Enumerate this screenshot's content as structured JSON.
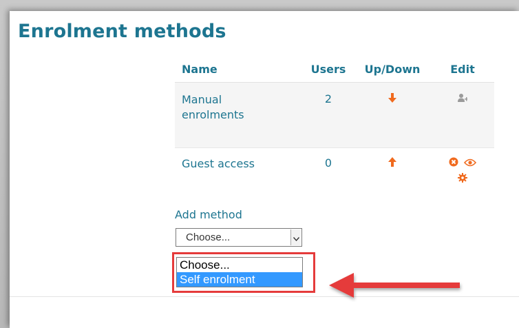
{
  "page": {
    "title": "Enrolment methods"
  },
  "table": {
    "headers": {
      "name": "Name",
      "users": "Users",
      "updown": "Up/Down",
      "edit": "Edit"
    },
    "rows": [
      {
        "name": "Manual enrolments",
        "users": "2",
        "updown": [
          "arrow-down-icon"
        ],
        "edit": [
          "enrol-users-icon"
        ]
      },
      {
        "name": "Guest access",
        "users": "0",
        "updown": [
          "arrow-up-icon"
        ],
        "edit": [
          "delete-icon",
          "show-hide-eye-icon",
          "settings-gear-icon"
        ]
      }
    ]
  },
  "add_method": {
    "label": "Add method",
    "selected": "Choose...",
    "options": [
      "Choose...",
      "Self enrolment"
    ],
    "highlighted_option": "Self enrolment"
  },
  "colors": {
    "link": "#1d7590",
    "accent_orange": "#f06a1e",
    "callout_red": "#e53b3b",
    "selection_blue": "#3399ff"
  }
}
